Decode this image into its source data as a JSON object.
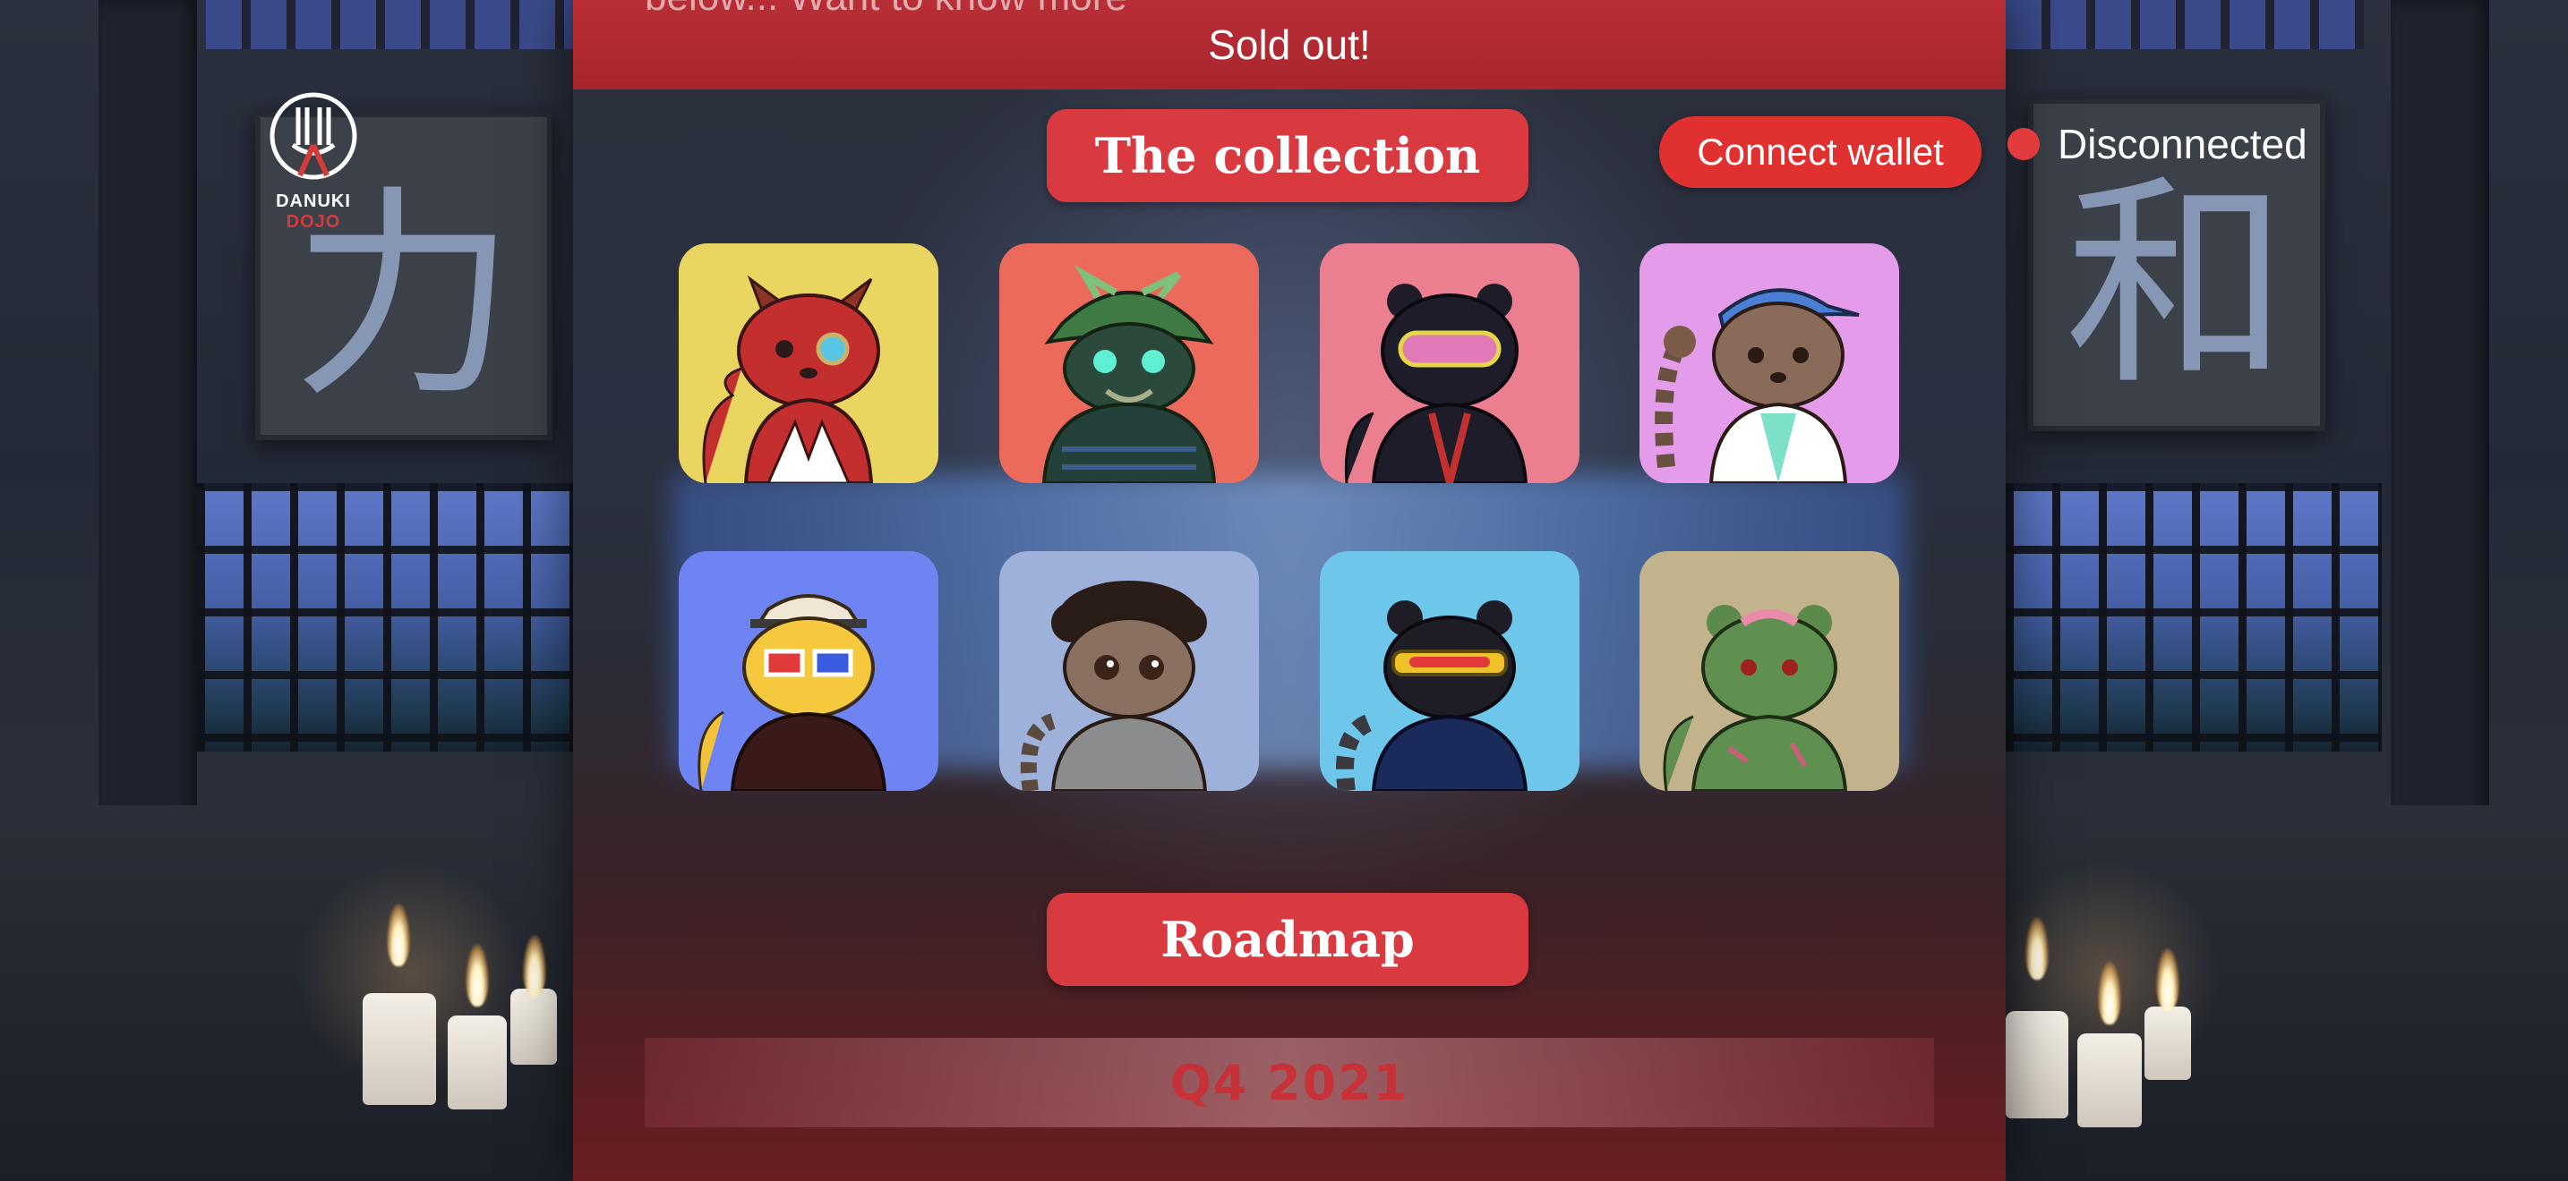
{
  "banner": {
    "text": "Sold out!",
    "ghost_text": "below... Want to know more"
  },
  "logo": {
    "name_part1": "DANUKI ",
    "name_part2": "DOJO"
  },
  "collection": {
    "title": "The collection",
    "items": [
      {
        "name": "red-tanuki-monocle",
        "bg": "#e9d55f"
      },
      {
        "name": "samurai-tanuki",
        "bg": "#ec6a5c"
      },
      {
        "name": "ninja-tanuki",
        "bg": "#ec7f8f"
      },
      {
        "name": "cap-tanuki",
        "bg": "#e39bea"
      },
      {
        "name": "3d-glasses-tanuki",
        "bg": "#6f84f3"
      },
      {
        "name": "curly-hair-tanuki",
        "bg": "#9db1da"
      },
      {
        "name": "visor-tanuki",
        "bg": "#6ec6eb"
      },
      {
        "name": "zombie-tanuki",
        "bg": "#c3b38d"
      }
    ]
  },
  "wallet": {
    "connect_label": "Connect wallet",
    "status_label": "Disconnected",
    "status_color": "#e23b3d"
  },
  "roadmap": {
    "title": "Roadmap",
    "quarter": "Q4 2021"
  },
  "scene": {
    "kanji_left": "力",
    "kanji_right": "和"
  },
  "colors": {
    "accent": "#d93a3f",
    "banner": "#b92e35"
  }
}
